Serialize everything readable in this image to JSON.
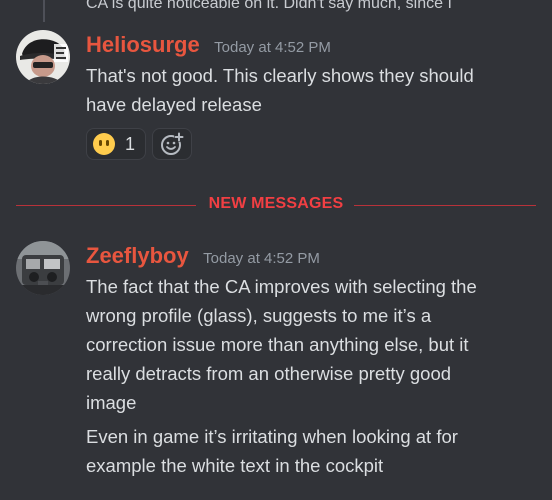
{
  "previous_message": {
    "text_cut": "CA is quite noticeable on it.  Didn't say much, since I"
  },
  "message1": {
    "username": "Heliosurge",
    "timestamp": "Today at 4:52 PM",
    "lines": [
      "That's not good.  This clearly shows they should",
      "have delayed release"
    ],
    "reactions": [
      {
        "emoji": "no-mouth-face-icon",
        "count": "1"
      }
    ]
  },
  "divider": {
    "label": "NEW MESSAGES",
    "color": "#f23f43"
  },
  "message2": {
    "username": "Zeeflyboy",
    "timestamp": "Today at 4:52 PM",
    "lines": [
      "The fact that the CA improves with selecting the",
      "wrong profile (glass), suggests to me it’s a",
      "correction issue more than anything else, but it",
      "really detracts from an otherwise pretty good",
      "image"
    ],
    "followup_lines": [
      "Even in game it’s irritating when looking at for",
      "example the white text in the cockpit"
    ]
  },
  "colors": {
    "background": "#313338",
    "username": "#e8563f",
    "timestamp": "#949ba4",
    "text": "#dbdee1"
  }
}
